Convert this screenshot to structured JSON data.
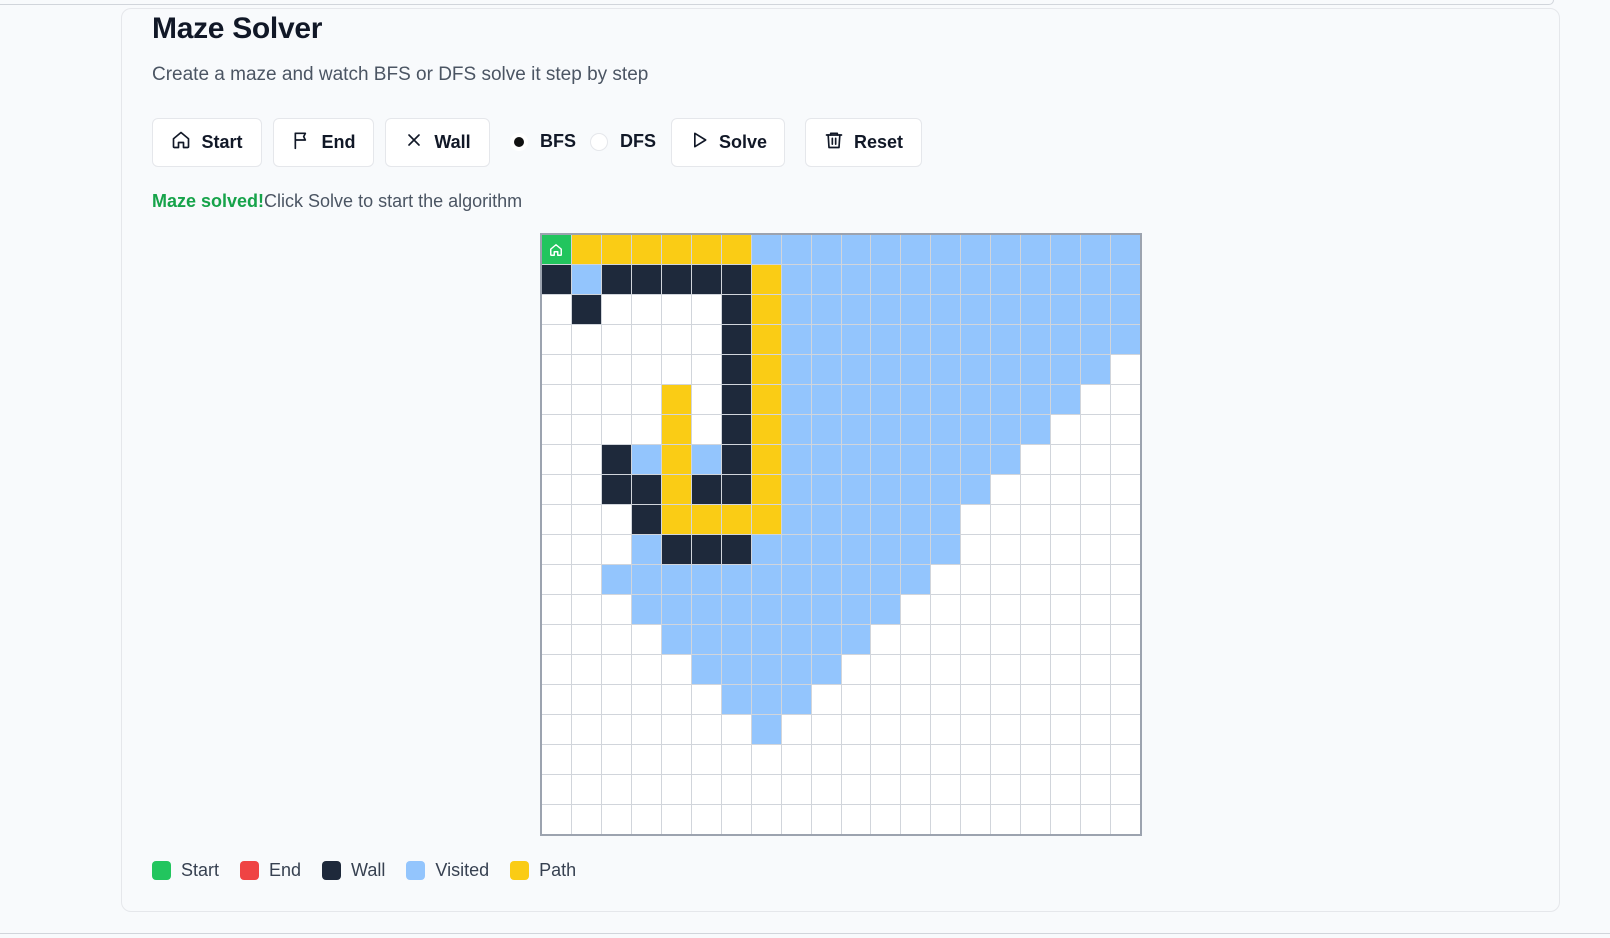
{
  "page": {
    "title": "Maze Solver",
    "subtitle": "Create a maze and watch BFS or DFS solve it step by step"
  },
  "toolbar": {
    "start_label": "Start",
    "end_label": "End",
    "wall_label": "Wall",
    "algorithms": [
      {
        "label": "BFS",
        "selected": true
      },
      {
        "label": "DFS",
        "selected": false
      }
    ],
    "solve_label": "Solve",
    "reset_label": "Reset"
  },
  "status": {
    "solved_text": "Maze solved!",
    "hint_text": "Click Solve to start the algorithm"
  },
  "maze": {
    "rows": 20,
    "cols": 20,
    "cell_types": {
      "S": "start",
      "E": "end",
      "#": "wall",
      "v": "visited",
      "p": "path",
      ".": "empty"
    },
    "cells": [
      "Sppppppvvvvvvvvvvvvv",
      "#v#####pvvvvvvvvvvvv",
      ".#....#pvvvvvvvvvvvv",
      "......#pvvvvvvvvvvvv",
      "......#pvvvvvvvvvvv.",
      "....p.#pvvvvvvvvvv..",
      "....p.#pvvvvvvvvv...",
      "..#vpv#pvvvvvvvv....",
      "..##p##pvvvvvvv.....",
      "...#ppppvvvvvv......",
      "...v###vvvvvvv......",
      "..vvvvvvvvvvv.......",
      "...vvvvvvvvv........",
      "....vvvvvvv.........",
      ".....vvvvv..........",
      "......vvv...........",
      ".......v............",
      "....................",
      "....................",
      "...................."
    ]
  },
  "legend": [
    {
      "label": "Start",
      "color": "#22c55e"
    },
    {
      "label": "End",
      "color": "#ef4444"
    },
    {
      "label": "Wall",
      "color": "#1e293b"
    },
    {
      "label": "Visited",
      "color": "#93c5fd"
    },
    {
      "label": "Path",
      "color": "#facc15"
    }
  ],
  "icons": {
    "start": "home-icon",
    "end": "flag-icon",
    "wall": "x-icon",
    "solve": "play-icon",
    "reset": "trash-icon"
  }
}
